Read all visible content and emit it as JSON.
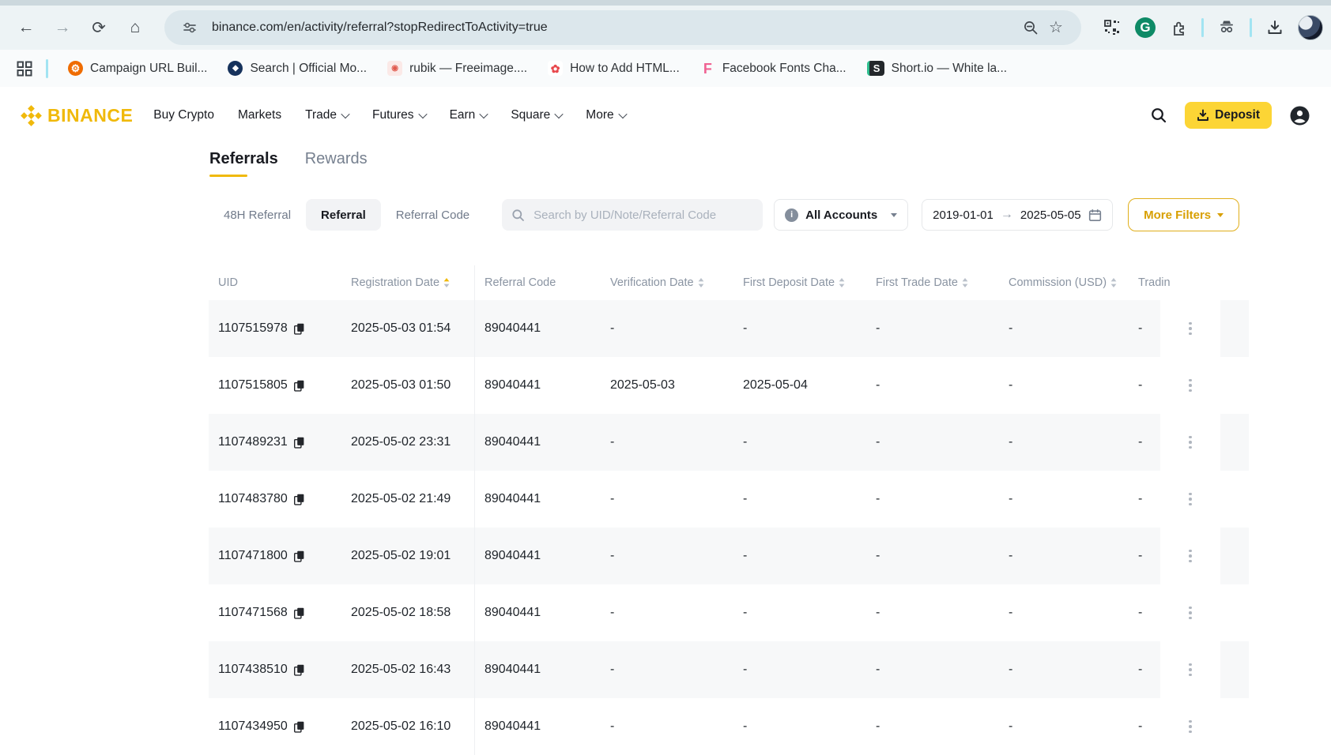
{
  "glyphs": {
    "back": "←",
    "forward": "→",
    "reload": "⟳",
    "home": "⌂",
    "star": "☆",
    "grammarly": "G",
    "date_arrow": "→"
  },
  "browser": {
    "url": "binance.com/en/activity/referral?stopRedirectToActivity=true",
    "bookmarks": [
      {
        "label": "Campaign URL Buil...",
        "icon": "campaign-gear",
        "glyph": "⚙"
      },
      {
        "label": "Search | Official Mo...",
        "icon": "search-diamond",
        "glyph": "◆"
      },
      {
        "label": "rubik — Freeimage....",
        "icon": "rubik-image",
        "glyph": "◉"
      },
      {
        "label": "How to Add HTML...",
        "icon": "html-rosette",
        "glyph": "✿"
      },
      {
        "label": "Facebook Fonts Cha...",
        "icon": "facebook-f",
        "glyph": "F"
      },
      {
        "label": "Short.io — White la...",
        "icon": "shortio-s",
        "glyph": "S"
      }
    ]
  },
  "site_header": {
    "brand": "BINANCE",
    "nav": [
      {
        "label": "Buy Crypto",
        "caret": false
      },
      {
        "label": "Markets",
        "caret": false
      },
      {
        "label": "Trade",
        "caret": true
      },
      {
        "label": "Futures",
        "caret": true
      },
      {
        "label": "Earn",
        "caret": true
      },
      {
        "label": "Square",
        "caret": true
      },
      {
        "label": "More",
        "caret": true
      }
    ],
    "deposit_label": "Deposit"
  },
  "page": {
    "tabs": [
      {
        "label": "Referrals",
        "active": true
      },
      {
        "label": "Rewards",
        "active": false
      }
    ],
    "filters": {
      "segments": [
        {
          "label": "48H Referral",
          "active": false
        },
        {
          "label": "Referral",
          "active": true
        },
        {
          "label": "Referral Code",
          "active": false
        }
      ],
      "search_placeholder": "Search by UID/Note/Referral Code",
      "account_label": "All Accounts",
      "date_from": "2019-01-01",
      "date_to": "2025-05-05",
      "more_filters_label": "More Filters"
    },
    "table": {
      "columns": [
        {
          "key": "uid",
          "label": "UID",
          "sort": "none"
        },
        {
          "key": "registration-date",
          "label": "Registration Date",
          "sort": "active"
        },
        {
          "key": "referral-code",
          "label": "Referral Code",
          "sort": "none"
        },
        {
          "key": "verification-date",
          "label": "Verification Date",
          "sort": "default"
        },
        {
          "key": "first-deposit-date",
          "label": "First Deposit Date",
          "sort": "default"
        },
        {
          "key": "first-trade-date",
          "label": "First Trade Date",
          "sort": "default"
        },
        {
          "key": "commission-usd",
          "label": "Commission (USD)",
          "sort": "default"
        },
        {
          "key": "trading",
          "label": "Tradin",
          "sort": "none"
        }
      ],
      "rows": [
        [
          "1107515978",
          "2025-05-03 01:54",
          "89040441",
          "-",
          "-",
          "-",
          "-",
          "-"
        ],
        [
          "1107515805",
          "2025-05-03 01:50",
          "89040441",
          "2025-05-03",
          "2025-05-04",
          "-",
          "-",
          "-"
        ],
        [
          "1107489231",
          "2025-05-02 23:31",
          "89040441",
          "-",
          "-",
          "-",
          "-",
          "-"
        ],
        [
          "1107483780",
          "2025-05-02 21:49",
          "89040441",
          "-",
          "-",
          "-",
          "-",
          "-"
        ],
        [
          "1107471800",
          "2025-05-02 19:01",
          "89040441",
          "-",
          "-",
          "-",
          "-",
          "-"
        ],
        [
          "1107471568",
          "2025-05-02 18:58",
          "89040441",
          "-",
          "-",
          "-",
          "-",
          "-"
        ],
        [
          "1107438510",
          "2025-05-02 16:43",
          "89040441",
          "-",
          "-",
          "-",
          "-",
          "-"
        ],
        [
          "1107434950",
          "2025-05-02 16:10",
          "89040441",
          "-",
          "-",
          "-",
          "-",
          "-"
        ]
      ]
    }
  },
  "colors": {
    "accent": "#F0B90B",
    "deposit_button": "#FCD535",
    "text_dark": "#181A20",
    "text_gray": "#707A8A",
    "row_stripe": "#F7F8F9",
    "gold_outline": "#E0AE1A"
  }
}
